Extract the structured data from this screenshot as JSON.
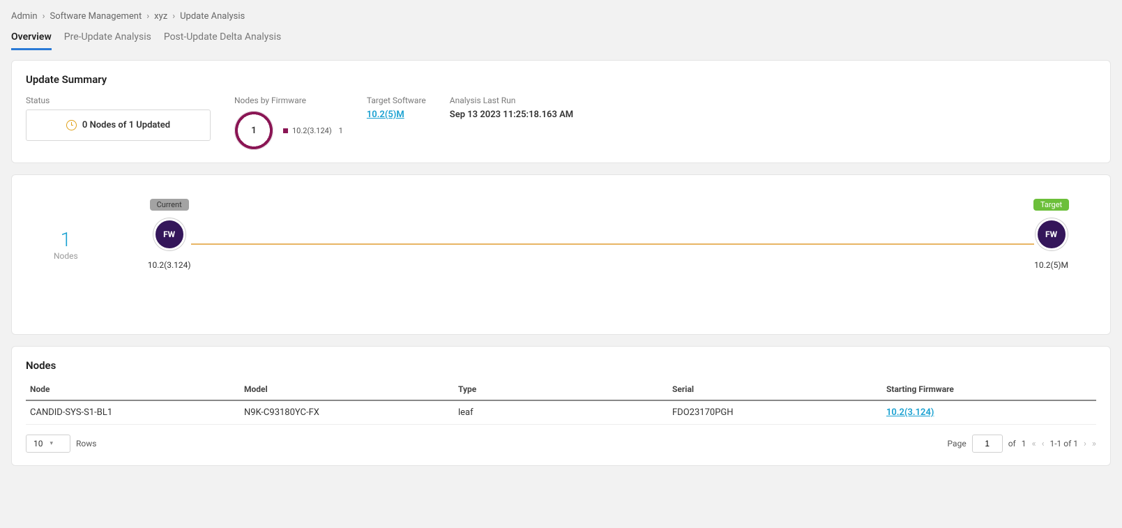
{
  "breadcrumbs": [
    "Admin",
    "Software Management",
    "xyz",
    "Update Analysis"
  ],
  "tabs": [
    {
      "label": "Overview",
      "active": true
    },
    {
      "label": "Pre-Update Analysis",
      "active": false
    },
    {
      "label": "Post-Update Delta Analysis",
      "active": false
    }
  ],
  "summary": {
    "title": "Update Summary",
    "status_label": "Status",
    "status_text": "0 Nodes of 1 Updated",
    "nodes_by_firmware_label": "Nodes by Firmware",
    "donut_total": "1",
    "legend_version": "10.2(3.124)",
    "legend_count": "1",
    "target_software_label": "Target Software",
    "target_software_value": "10.2(5)M",
    "analysis_last_run_label": "Analysis Last Run",
    "analysis_last_run_value": "Sep 13 2023 11:25:18.163 AM"
  },
  "flow": {
    "nodes_count": "1",
    "nodes_label": "Nodes",
    "fw_abbrev": "FW",
    "current_badge": "Current",
    "current_version": "10.2(3.124)",
    "target_badge": "Target",
    "target_version": "10.2(5)M"
  },
  "nodes_table": {
    "title": "Nodes",
    "columns": [
      "Node",
      "Model",
      "Type",
      "Serial",
      "Starting Firmware"
    ],
    "rows": [
      {
        "node": "CANDID-SYS-S1-BL1",
        "model": "N9K-C93180YC-FX",
        "type": "leaf",
        "serial": "FDO23170PGH",
        "starting_firmware": "10.2(3.124)"
      }
    ]
  },
  "pager": {
    "rows_value": "10",
    "rows_label": "Rows",
    "page_label": "Page",
    "page_value": "1",
    "of_label": "of",
    "total_pages": "1",
    "range_text": "1-1 of 1"
  },
  "chart_data": {
    "type": "pie",
    "title": "Nodes by Firmware",
    "categories": [
      "10.2(3.124)"
    ],
    "values": [
      1
    ],
    "total": 1
  }
}
